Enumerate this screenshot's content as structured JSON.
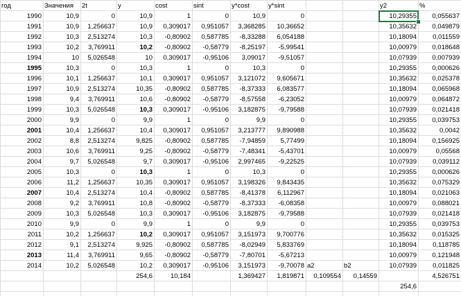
{
  "headers": {
    "A": "год",
    "B": "Значения",
    "C": "2t",
    "D": "y",
    "E": "cost",
    "F": "sint",
    "G": "y*cost",
    "H": "y*sint",
    "L": "y2",
    "M": "%"
  },
  "rows": [
    {
      "year": "1990",
      "year_bold": false,
      "val": "10,9",
      "t2": "0",
      "y": "10,9",
      "y_bold": false,
      "cost": "1",
      "sint": "0",
      "ycost": "10,9",
      "ysint": "0",
      "y2": "10,29355",
      "pct": "0,055637"
    },
    {
      "year": "1991",
      "year_bold": false,
      "val": "10,9",
      "t2": "1,256637",
      "y": "10,9",
      "y_bold": false,
      "cost": "0,309017",
      "sint": "0,951057",
      "ycost": "3,368285",
      "ysint": "10,36652",
      "y2": "10,35632",
      "pct": "0,049879"
    },
    {
      "year": "1992",
      "year_bold": false,
      "val": "10,3",
      "t2": "2,513274",
      "y": "10,3",
      "y_bold": false,
      "cost": "-0,80902",
      "sint": "0,587785",
      "ycost": "-8,33288",
      "ysint": "6,054188",
      "y2": "10,18094",
      "pct": "0,011559"
    },
    {
      "year": "1993",
      "year_bold": false,
      "val": "10,2",
      "t2": "3,769911",
      "y": "10,2",
      "y_bold": true,
      "cost": "-0,80902",
      "sint": "-0,58779",
      "ycost": "-8,25197",
      "ysint": "-5,99541",
      "y2": "10,00979",
      "pct": "0,018648"
    },
    {
      "year": "1994",
      "year_bold": false,
      "val": "10",
      "t2": "5,026548",
      "y": "10",
      "y_bold": false,
      "cost": "0,309017",
      "sint": "-0,95106",
      "ycost": "3,09017",
      "ysint": "-9,51057",
      "y2": "10,07939",
      "pct": "0,007939"
    },
    {
      "year": "1995",
      "year_bold": true,
      "val": "10,3",
      "t2": "0",
      "y": "10,3",
      "y_bold": false,
      "cost": "1",
      "sint": "0",
      "ycost": "10,3",
      "ysint": "0",
      "y2": "10,29355",
      "pct": "0,000626"
    },
    {
      "year": "1996",
      "year_bold": false,
      "val": "10,1",
      "t2": "1,256637",
      "y": "10,1",
      "y_bold": false,
      "cost": "0,309017",
      "sint": "0,951057",
      "ycost": "3,121072",
      "ysint": "9,605671",
      "y2": "10,35632",
      "pct": "0,025378"
    },
    {
      "year": "1997",
      "year_bold": false,
      "val": "10,9",
      "t2": "2,513274",
      "y": "10,35",
      "y_bold": false,
      "cost": "-0,80902",
      "sint": "0,587785",
      "ycost": "-8,37333",
      "ysint": "6,083577",
      "y2": "10,18094",
      "pct": "0,065968"
    },
    {
      "year": "1998",
      "year_bold": false,
      "val": "9,4",
      "t2": "3,769911",
      "y": "10,6",
      "y_bold": false,
      "cost": "-0,80902",
      "sint": "-0,58779",
      "ycost": "-8,57558",
      "ysint": "-6,23052",
      "y2": "10,00979",
      "pct": "0,064872"
    },
    {
      "year": "1999",
      "year_bold": false,
      "val": "10,3",
      "t2": "5,026548",
      "y": "10,3",
      "y_bold": true,
      "cost": "0,309017",
      "sint": "-0,95106",
      "ycost": "3,182875",
      "ysint": "-9,79588",
      "y2": "10,07939",
      "pct": "0,021418"
    },
    {
      "year": "2000",
      "year_bold": false,
      "val": "9,9",
      "t2": "0",
      "y": "9,9",
      "y_bold": false,
      "cost": "1",
      "sint": "0",
      "ycost": "9,9",
      "ysint": "0",
      "y2": "10,29355",
      "pct": "0,039753"
    },
    {
      "year": "2001",
      "year_bold": true,
      "val": "10,4",
      "t2": "1,256637",
      "y": "10,4",
      "y_bold": false,
      "cost": "0,309017",
      "sint": "0,951057",
      "ycost": "3,213777",
      "ysint": "9,890988",
      "y2": "10,35632",
      "pct": "0,0042"
    },
    {
      "year": "2002",
      "year_bold": false,
      "val": "8,8",
      "t2": "2,513274",
      "y": "9,825",
      "y_bold": false,
      "cost": "-0,80902",
      "sint": "0,587785",
      "ycost": "-7,94859",
      "ysint": "5,77499",
      "y2": "10,18094",
      "pct": "0,156925"
    },
    {
      "year": "2003",
      "year_bold": false,
      "val": "10,6",
      "t2": "3,769911",
      "y": "9,25",
      "y_bold": false,
      "cost": "-0,80902",
      "sint": "-0,58779",
      "ycost": "-7,48341",
      "ysint": "-5,43701",
      "y2": "10,00979",
      "pct": "0,05568"
    },
    {
      "year": "2004",
      "year_bold": false,
      "val": "9,7",
      "t2": "5,026548",
      "y": "9,7",
      "y_bold": false,
      "cost": "0,309017",
      "sint": "-0,95106",
      "ycost": "2,997465",
      "ysint": "-9,22525",
      "y2": "10,07939",
      "pct": "0,039112"
    },
    {
      "year": "2005",
      "year_bold": false,
      "val": "10,3",
      "t2": "0",
      "y": "10,3",
      "y_bold": true,
      "cost": "1",
      "sint": "0",
      "ycost": "10,3",
      "ysint": "0",
      "y2": "10,29355",
      "pct": "0,000626"
    },
    {
      "year": "2006",
      "year_bold": false,
      "val": "11,2",
      "t2": "1,256637",
      "y": "10,35",
      "y_bold": false,
      "cost": "0,309017",
      "sint": "0,951057",
      "ycost": "3,198326",
      "ysint": "9,843435",
      "y2": "10,35632",
      "pct": "0,075329"
    },
    {
      "year": "2007",
      "year_bold": true,
      "val": "10,4",
      "t2": "2,513274",
      "y": "10,4",
      "y_bold": false,
      "cost": "-0,80902",
      "sint": "0,587785",
      "ycost": "-8,41378",
      "ysint": "6,112967",
      "y2": "10,18094",
      "pct": "0,021063"
    },
    {
      "year": "2008",
      "year_bold": false,
      "val": "9,2",
      "t2": "3,769911",
      "y": "10,8",
      "y_bold": false,
      "cost": "-0,80902",
      "sint": "-0,58779",
      "ycost": "-8,37333",
      "ysint": "-6,08358",
      "y2": "10,00979",
      "pct": "0,088021"
    },
    {
      "year": "2009",
      "year_bold": false,
      "val": "10,3",
      "t2": "5,026548",
      "y": "10,3",
      "y_bold": false,
      "cost": "0,309017",
      "sint": "-0,95106",
      "ycost": "3,182875",
      "ysint": "-9,79588",
      "y2": "10,07939",
      "pct": "0,021418"
    },
    {
      "year": "2010",
      "year_bold": false,
      "val": "9,9",
      "t2": "0",
      "y": "9,9",
      "y_bold": false,
      "cost": "1",
      "sint": "0",
      "ycost": "9,9",
      "ysint": "0",
      "y2": "10,29355",
      "pct": "0,039753"
    },
    {
      "year": "2011",
      "year_bold": false,
      "val": "10,2",
      "t2": "1,256637",
      "y": "10,2",
      "y_bold": true,
      "cost": "0,309017",
      "sint": "0,951057",
      "ycost": "3,151973",
      "ysint": "9,700776",
      "y2": "10,35632",
      "pct": "0,015325"
    },
    {
      "year": "2012",
      "year_bold": false,
      "val": "9,1",
      "t2": "2,513274",
      "y": "9,925",
      "y_bold": false,
      "cost": "-0,80902",
      "sint": "0,587785",
      "ycost": "-8,02949",
      "ysint": "5,833769",
      "y2": "10,18094",
      "pct": "0,118785"
    },
    {
      "year": "2013",
      "year_bold": true,
      "val": "11,4",
      "t2": "3,769911",
      "y": "9,65",
      "y_bold": false,
      "cost": "-0,80902",
      "sint": "-0,58779",
      "ycost": "-7,80701",
      "ysint": "-5,67213",
      "y2": "10,00979",
      "pct": "0,121948"
    },
    {
      "year": "2014",
      "year_bold": false,
      "val": "10,2",
      "t2": "5,026548",
      "y": "10,2",
      "y_bold": false,
      "cost": "0,309017",
      "sint": "-0,95106",
      "ycost": "3,151973",
      "ysint": "-9,70078",
      "y2": "10,07939",
      "pct": "0,011825"
    }
  ],
  "extra_labels": {
    "a2": "a2",
    "b2": "b2"
  },
  "totals": {
    "y_sum": "254,6",
    "cost_sum": "10,184",
    "ycost_sum": "1,369427",
    "ysint_sum": "1,819871",
    "a2_val": "0,109554",
    "b2_val": "0,14559",
    "pct_sum": "4,526751",
    "y2_sum": "254,6"
  }
}
